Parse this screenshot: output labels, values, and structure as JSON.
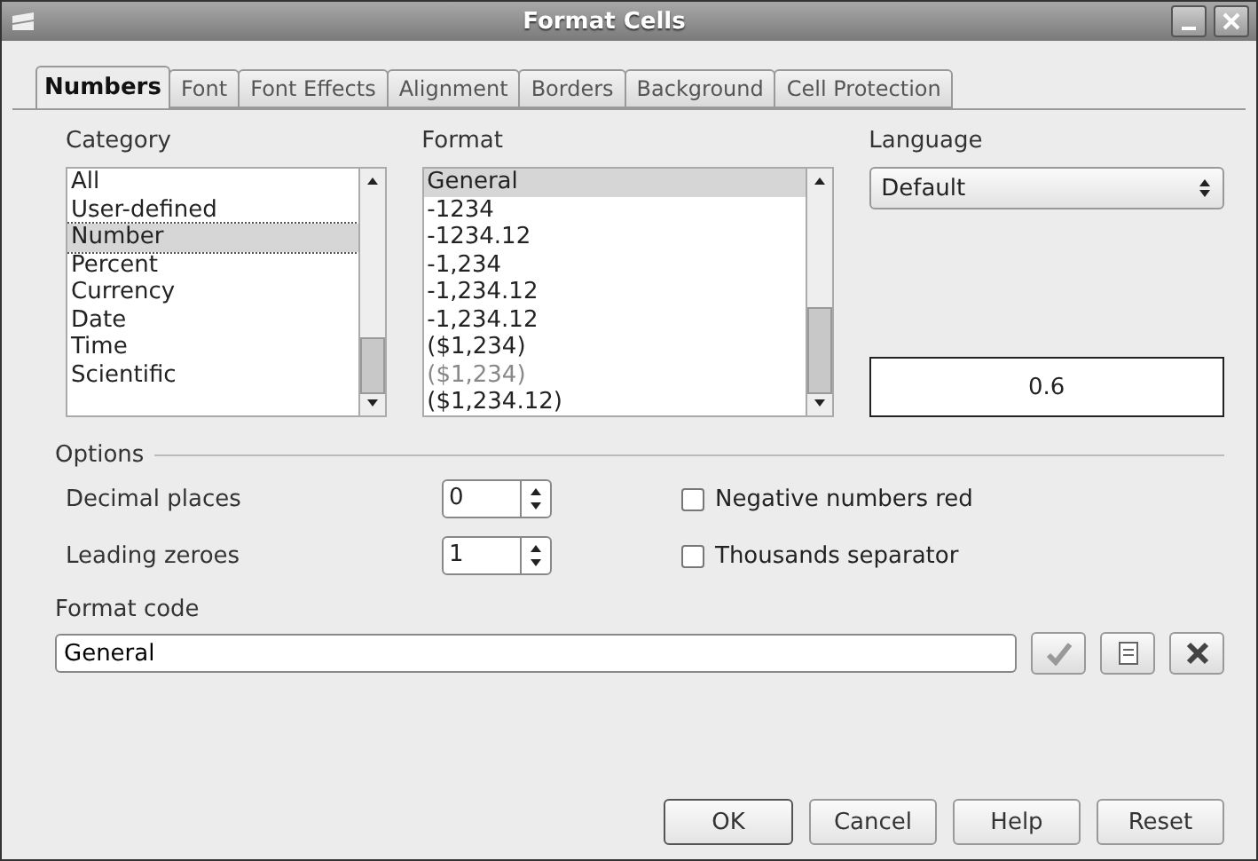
{
  "window": {
    "title": "Format Cells"
  },
  "tabs": [
    {
      "label": "Numbers",
      "selected": true
    },
    {
      "label": "Font",
      "selected": false
    },
    {
      "label": "Font Effects",
      "selected": false
    },
    {
      "label": "Alignment",
      "selected": false
    },
    {
      "label": "Borders",
      "selected": false
    },
    {
      "label": "Background",
      "selected": false
    },
    {
      "label": "Cell Protection",
      "selected": false
    }
  ],
  "category": {
    "label": "Category",
    "items": [
      {
        "text": "All",
        "selected": false
      },
      {
        "text": "User-defined",
        "selected": false
      },
      {
        "text": "Number",
        "selected": true
      },
      {
        "text": "Percent",
        "selected": false
      },
      {
        "text": "Currency",
        "selected": false
      },
      {
        "text": "Date",
        "selected": false
      },
      {
        "text": "Time",
        "selected": false
      },
      {
        "text": "Scientific",
        "selected": false
      }
    ]
  },
  "format": {
    "label": "Format",
    "items": [
      {
        "text": "General",
        "selected": true,
        "dimmed": false
      },
      {
        "text": "-1234",
        "selected": false,
        "dimmed": false
      },
      {
        "text": "-1234.12",
        "selected": false,
        "dimmed": false
      },
      {
        "text": "-1,234",
        "selected": false,
        "dimmed": false
      },
      {
        "text": "-1,234.12",
        "selected": false,
        "dimmed": false
      },
      {
        "text": "-1,234.12",
        "selected": false,
        "dimmed": false
      },
      {
        "text": "($1,234)",
        "selected": false,
        "dimmed": false
      },
      {
        "text": "($1,234)",
        "selected": false,
        "dimmed": true
      },
      {
        "text": "($1,234.12)",
        "selected": false,
        "dimmed": false
      }
    ]
  },
  "language": {
    "label": "Language",
    "value": "Default"
  },
  "preview": "0.6",
  "options": {
    "title": "Options",
    "spinners": [
      {
        "label": "Decimal places",
        "value": "0"
      },
      {
        "label": "Leading zeroes",
        "value": "1"
      }
    ],
    "checkboxes": [
      {
        "label": "Negative numbers red",
        "checked": false
      },
      {
        "label": "Thousands separator",
        "checked": false
      }
    ]
  },
  "format_code": {
    "label": "Format code",
    "value": "General"
  },
  "buttons": [
    "OK",
    "Cancel",
    "Help",
    "Reset"
  ]
}
